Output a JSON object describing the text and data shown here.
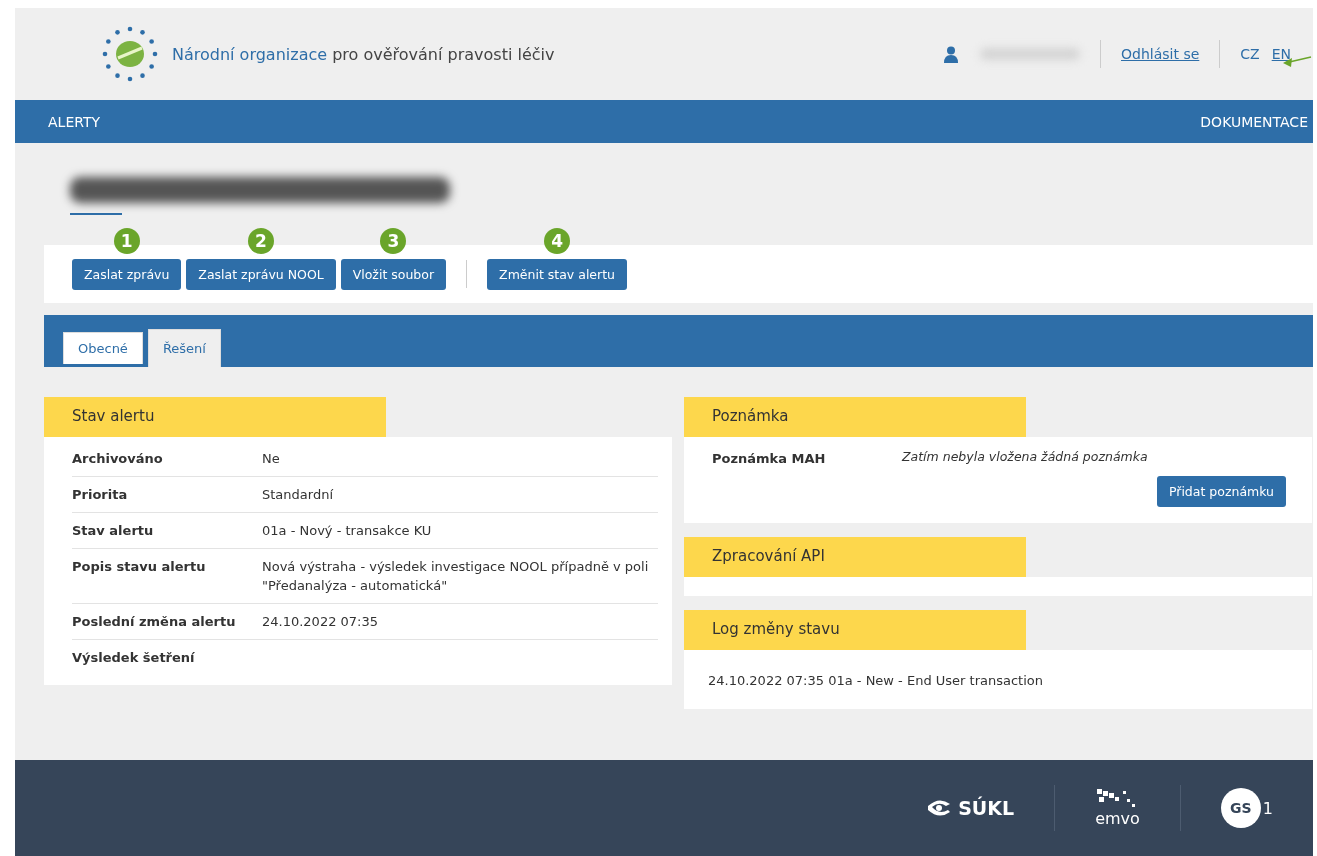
{
  "header": {
    "org_name_highlight": "Národní organizace",
    "org_name_rest": "pro ověřování pravosti léčiv",
    "logout": "Odhlásit se",
    "languages": [
      {
        "label": "CZ",
        "selected": true
      },
      {
        "label": "EN",
        "selected": false
      }
    ]
  },
  "nav": {
    "left": "ALERTY",
    "right": "DOKUMENTACE"
  },
  "actions": [
    {
      "label": "Zaslat zprávu",
      "badge": "1"
    },
    {
      "label": "Zaslat zprávu NOOL",
      "badge": "2"
    },
    {
      "label": "Vložit soubor",
      "badge": "3"
    },
    {
      "label": "Změnit stav alertu",
      "badge": "4",
      "separated": true
    }
  ],
  "tabs": [
    {
      "label": "Obecné",
      "selected": false
    },
    {
      "label": "Řešení",
      "selected": true
    }
  ],
  "status_panel": {
    "title": "Stav alertu",
    "rows": [
      {
        "label": "Archivováno",
        "value": "Ne"
      },
      {
        "label": "Priorita",
        "value": "Standardní"
      },
      {
        "label": "Stav alertu",
        "value": "01a - Nový - transakce KU"
      },
      {
        "label": "Popis stavu alertu",
        "value": "Nová výstraha - výsledek investigace NOOL případně v poli \"Předanalýza - automatická\""
      },
      {
        "label": "Poslední změna alertu",
        "value": "24.10.2022 07:35"
      },
      {
        "label": "Výsledek šetření",
        "value": ""
      }
    ]
  },
  "note_panel": {
    "title": "Poznámka",
    "label": "Poznámka MAH",
    "value": "Zatím nebyla vložena žádná poznámka",
    "button": "Přidat poznámku"
  },
  "api_panel": {
    "title": "Zpracování API"
  },
  "log_panel": {
    "title": "Log změny stavu",
    "entries": [
      "24.10.2022 07:35 01a - New - End User transaction"
    ]
  },
  "footer": {
    "logos": [
      {
        "kind": "sukl",
        "text": "SÚKL"
      },
      {
        "kind": "emvo",
        "text": "emvo"
      },
      {
        "kind": "gs1",
        "text": "GS",
        "suffix": "1"
      }
    ]
  }
}
